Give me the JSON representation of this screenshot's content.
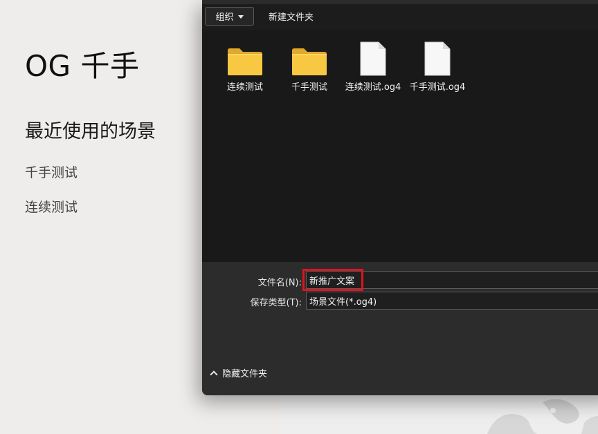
{
  "app": {
    "title": "OG 千手",
    "recent_heading": "最近使用的场景",
    "recent_items": [
      "千手测试",
      "连续测试"
    ]
  },
  "dialog": {
    "toolbar": {
      "organize_label": "组织",
      "new_folder_label": "新建文件夹"
    },
    "files": [
      {
        "name": "连续测试",
        "type": "folder",
        "icon": "folder-icon"
      },
      {
        "name": "千手测试",
        "type": "folder",
        "icon": "folder-icon"
      },
      {
        "name": "连续测试.og4",
        "type": "file",
        "icon": "document-icon"
      },
      {
        "name": "千手测试.og4",
        "type": "file",
        "icon": "document-icon"
      }
    ],
    "filename_label": "文件名(N):",
    "filename_value": "新推广文案",
    "filetype_label": "保存类型(T):",
    "filetype_value": "场景文件(*.og4)",
    "hide_folders_label": "隐藏文件夹"
  },
  "colors": {
    "dialog_bg": "#202020",
    "file_area_bg": "#191919",
    "panel_bg": "#2c2c2c",
    "folder_yellow": "#f8c842",
    "highlight_red": "#e0141e"
  }
}
